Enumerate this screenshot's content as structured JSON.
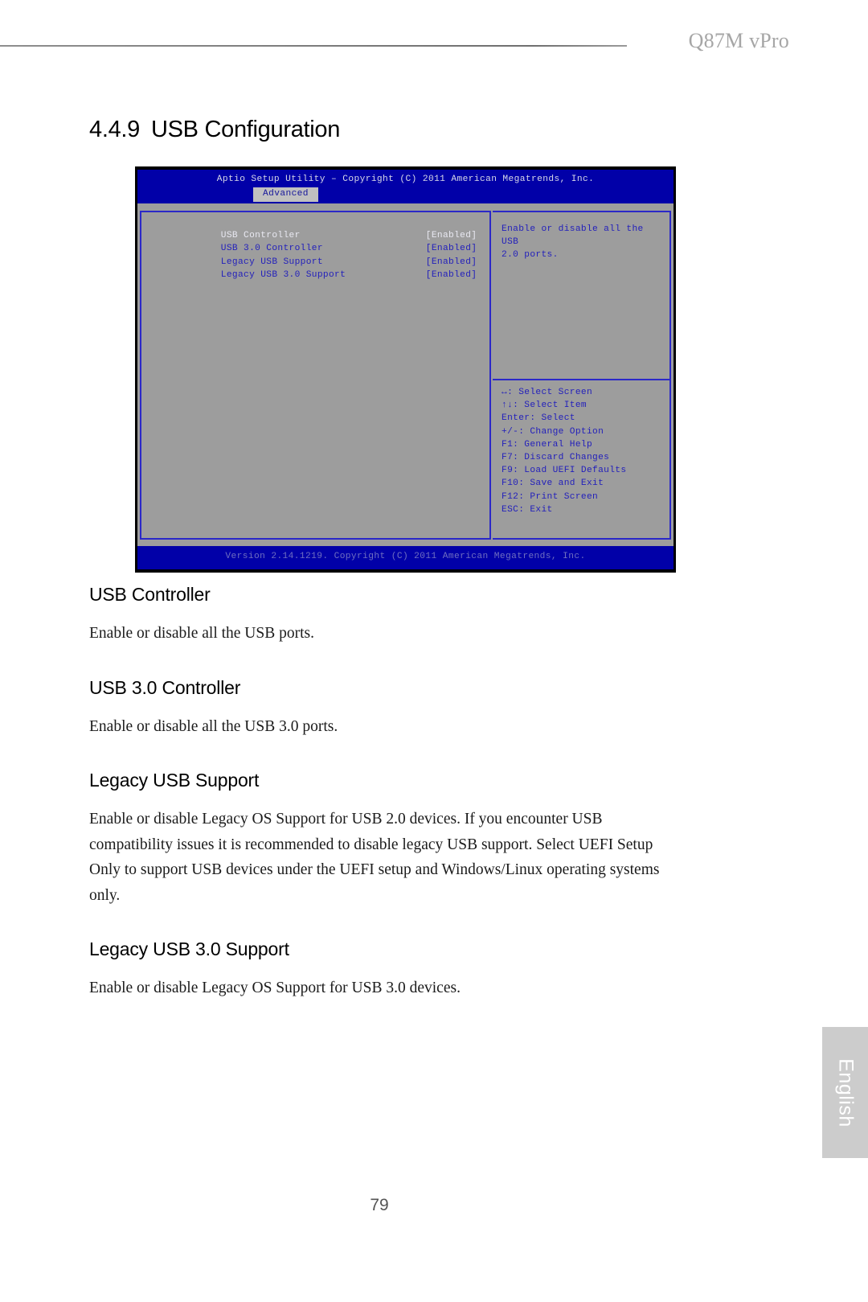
{
  "header": {
    "model": "Q87M vPro"
  },
  "section": {
    "number": "4.4.9",
    "title": "USB Configuration"
  },
  "bios": {
    "title": "Aptio Setup Utility – Copyright (C) 2011 American Megatrends, Inc.",
    "tab": "Advanced",
    "settings": [
      {
        "label": "USB Controller",
        "value": "[Enabled]",
        "selected": true
      },
      {
        "label": "USB 3.0 Controller",
        "value": "[Enabled]",
        "selected": false
      },
      {
        "label": "Legacy USB Support",
        "value": "[Enabled]",
        "selected": false
      },
      {
        "label": "Legacy USB 3.0 Support",
        "value": "[Enabled]",
        "selected": false
      }
    ],
    "help_text": "Enable or disable all the USB\n2.0 ports.",
    "nav_keys": [
      "↔: Select Screen",
      "↑↓: Select Item",
      "Enter: Select",
      "+/-: Change Option",
      "F1: General Help",
      "F7: Discard Changes",
      "F9: Load UEFI Defaults",
      "F10: Save and Exit",
      "F12: Print Screen",
      "ESC: Exit"
    ],
    "footer": "Version 2.14.1219. Copyright (C) 2011 American Megatrends, Inc.",
    "colors": {
      "titlebar": "#0100a8",
      "panel_bg": "#9d9d9d",
      "text": "#2320bb",
      "selected_text": "#e9e9f2",
      "border": "#2b28c8"
    }
  },
  "sections": [
    {
      "heading": "USB Controller",
      "body": "Enable or disable all the USB ports."
    },
    {
      "heading": "USB 3.0 Controller",
      "body": "Enable or disable all the USB 3.0 ports."
    },
    {
      "heading": "Legacy USB Support",
      "body": "Enable or disable Legacy OS Support for USB 2.0 devices. If you encounter USB compatibility issues it is recommended to disable legacy USB support. Select UEFI Setup Only to support USB devices under the UEFI setup and Windows/Linux operating systems only."
    },
    {
      "heading": "Legacy USB 3.0 Support",
      "body": "Enable or disable Legacy OS Support for USB 3.0 devices."
    }
  ],
  "footer": {
    "language_tab": "English",
    "page_number": "79"
  }
}
